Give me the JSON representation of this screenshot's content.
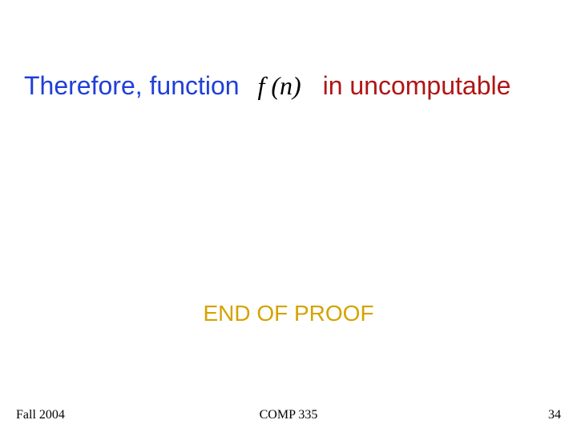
{
  "headline": {
    "prefix": "Therefore, function",
    "math": "f (n)",
    "suffix": "in uncomputable"
  },
  "end_of_proof": "END OF PROOF",
  "footer": {
    "left": "Fall 2004",
    "center": "COMP 335",
    "right": "34"
  }
}
